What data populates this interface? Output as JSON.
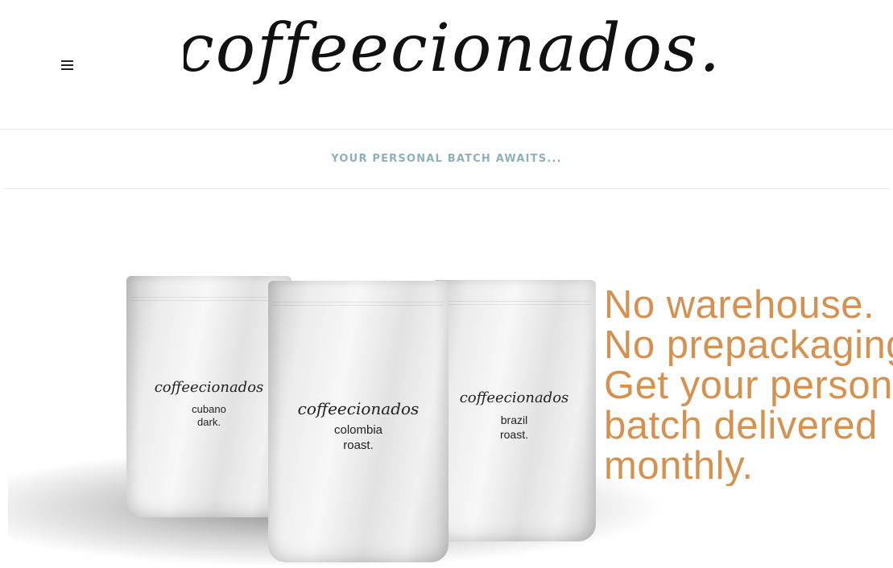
{
  "header": {
    "menu_icon": "hamburger-menu-icon",
    "logo_text": "coffeecionados."
  },
  "tagline": {
    "text": "YOUR PERSONAL BATCH AWAITS..."
  },
  "hero": {
    "bags": [
      {
        "brand": "coffeecionados",
        "line1": "cubano",
        "line2": "dark."
      },
      {
        "brand": "coffeecionados",
        "line1": "colombia",
        "line2": "roast."
      },
      {
        "brand": "coffeecionados",
        "line1": "brazil",
        "line2": "roast."
      }
    ],
    "headline_lines": [
      "No warehouse.",
      "No prepackaging.",
      "Get your personal",
      "batch delivered",
      "monthly."
    ]
  },
  "colors": {
    "tagline": "#8fb0b8",
    "headline": "#d49150",
    "logo": "#111111"
  }
}
